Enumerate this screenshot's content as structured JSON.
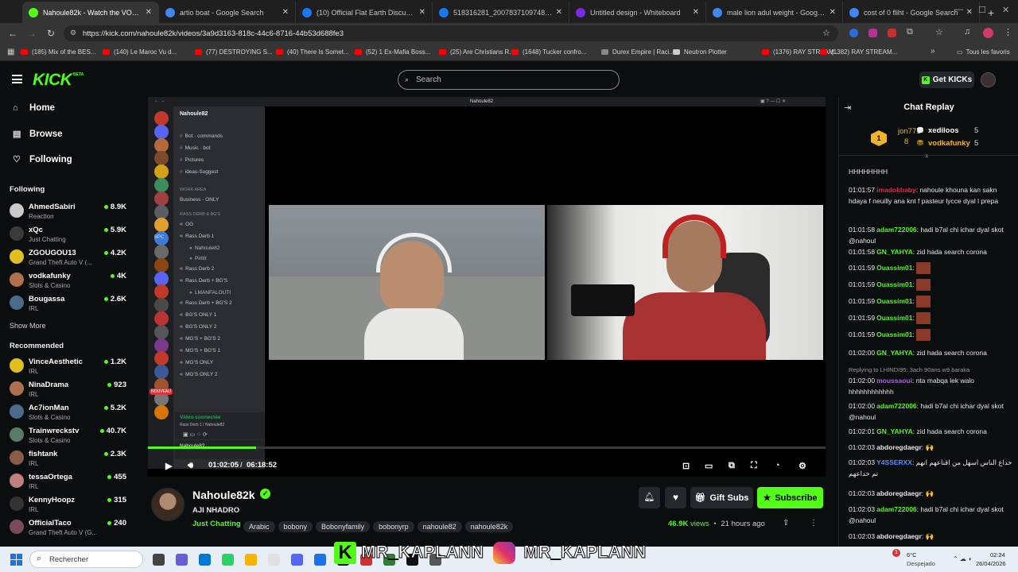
{
  "browser": {
    "tabs": [
      {
        "title": "Nahoule82k - Watch the VOD on",
        "active": true,
        "favicon": "kick-icon",
        "color": "#53fc18"
      },
      {
        "title": "artio boat - Google Search",
        "favicon": "google-icon",
        "color": "#4285f4"
      },
      {
        "title": "(10) Official Flat Earth Discussio",
        "favicon": "facebook-icon",
        "color": "#1877f2"
      },
      {
        "title": "518316281_20078371097482647",
        "favicon": "facebook-icon",
        "color": "#1877f2"
      },
      {
        "title": "Untitled design - Whiteboard",
        "favicon": "canva-icon",
        "color": "#7d2ae8"
      },
      {
        "title": "male lion adul weight - Google S",
        "favicon": "google-icon",
        "color": "#4285f4"
      },
      {
        "title": "cost of 0 fliht - Google Search",
        "favicon": "google-icon",
        "color": "#4285f4"
      }
    ],
    "new_tab": "+",
    "url": "https://kick.com/nahoule82k/videos/3a9d3163-818c-44c6-8716-44b53d688fe3",
    "bookmarks": [
      {
        "label": "(185) Mix of the BES..."
      },
      {
        "label": "(140) Le Maroc Vu d..."
      },
      {
        "label": "(77) DESTROYING S..."
      },
      {
        "label": "(40) There Is Somet..."
      },
      {
        "label": "(52) 1 Ex-Mafia Boss..."
      },
      {
        "label": "(25) Are Christians R..."
      },
      {
        "label": "(1648) Tucker confro..."
      },
      {
        "label": "Durex Empire | Raci..."
      },
      {
        "label": "Neutron Plotter"
      },
      {
        "label": "(1376) RAY STREAM..."
      },
      {
        "label": "(1382) RAY STREAM..."
      }
    ],
    "all_favorites": "Tous les favoris",
    "more": "»"
  },
  "header": {
    "logo": "KICK",
    "beta": "BETA",
    "search_placeholder": "Search",
    "get_kicks": "Get KICKs"
  },
  "sidebar": {
    "nav": [
      "Home",
      "Browse",
      "Following"
    ],
    "following_title": "Following",
    "following": [
      {
        "name": "AhmedSabiri",
        "category": "Reaction",
        "viewers": "8.9K"
      },
      {
        "name": "xQc",
        "category": "Just Chatting",
        "viewers": "5.9K"
      },
      {
        "name": "ZGOUGOU13",
        "category": "Grand Theft Auto V (...",
        "viewers": "4.2K"
      },
      {
        "name": "vodkafunky",
        "category": "Slots & Casino",
        "viewers": "4K"
      },
      {
        "name": "Bougassa",
        "category": "IRL",
        "viewers": "2.6K"
      }
    ],
    "show_more": "Show More",
    "recommended_title": "Recommended",
    "recommended": [
      {
        "name": "VinceAesthetic",
        "category": "IRL",
        "viewers": "1.2K"
      },
      {
        "name": "NinaDrama",
        "category": "IRL",
        "viewers": "923"
      },
      {
        "name": "Ac7ionMan",
        "category": "Slots & Casino",
        "viewers": "5.2K"
      },
      {
        "name": "Trainwreckstv",
        "category": "Slots & Casino",
        "viewers": "40.7K"
      },
      {
        "name": "fishtank",
        "category": "IRL",
        "viewers": "2.3K"
      },
      {
        "name": "tessaOrtega",
        "category": "IRL",
        "viewers": "455"
      },
      {
        "name": "KennyHoopz",
        "category": "IRL",
        "viewers": "315"
      },
      {
        "name": "OfficialTaco",
        "category": "Grand Theft Auto V (G...",
        "viewers": "240"
      }
    ]
  },
  "video": {
    "window_title": "Nahoule82",
    "discord": {
      "server": "Nahoule82",
      "channels": [
        {
          "name": "Bot · commands",
          "type": "hash"
        },
        {
          "name": "Music · bot",
          "type": "hash"
        },
        {
          "name": "Pictures",
          "type": "hash"
        },
        {
          "name": "ideas-Suggest",
          "type": "hash"
        }
      ],
      "category1": "WORK AREA",
      "business": "Business - ONLY",
      "category2": "RASS DERB & BG'S",
      "voice": [
        "OG",
        "Rass Derb 1",
        "Nahoule82",
        "Pirlitt",
        "Rass Derb 2",
        "Rass Derb + BG'S",
        "LMANFALOUTI",
        "Rass Derb + BG'S 2",
        "BG'S ONLY 1",
        "BG'S ONLY 2",
        "MG'S + BG'S 2",
        "MG'S + BG'S 1",
        "MG'S ONLY",
        "MG'S ONLY 2"
      ],
      "status_text": "Vidéo connectée",
      "status_sub": "Rass Derb 1 / Nahoule82",
      "user": "Nahoule82",
      "nouveau": "NOUVEAU",
      "bpc": "BPC"
    },
    "progress_fraction": 0.16,
    "time_current": "01:02:05",
    "time_total": "06:18:52"
  },
  "stream": {
    "channel": "Nahoule82k",
    "title": "AJI NHADRO",
    "category": "Just Chatting",
    "tags": [
      "Arabic",
      "bobony",
      "Bobonyfamily",
      "bobonyrp",
      "nahoule82",
      "nahoule82k"
    ],
    "views": "46.9K",
    "views_label": "views",
    "sep": "•",
    "posted": "21 hours ago",
    "gift_subs": "Gift Subs",
    "subscribe": "Subscribe"
  },
  "chat": {
    "title": "Chat Replay",
    "leaderboard": [
      {
        "name": "jon771",
        "count": "8"
      },
      {
        "name": "xediloos",
        "count": "5"
      },
      {
        "name": "vodkafunky",
        "count": "5"
      }
    ],
    "messages": [
      {
        "time": "",
        "user": "",
        "color": "#e8e8e8",
        "text": "HHHHHHHH"
      },
      {
        "time": "01:01:57",
        "user": "imadokbaby",
        "color": "#e0294d",
        "text": "nahoule khouna kan sakn hdaya f neuilly ana knt f pasteur lycce dyal l prepa"
      },
      {
        "time": "01:01:58",
        "user": "adam722006",
        "color": "#53fc18",
        "text": "hadi b7al chi ichar dyal skot @nahoul"
      },
      {
        "time": "01:01:58",
        "user": "GN_YAHYA",
        "color": "#53fc18",
        "text": "zid hada search corona"
      },
      {
        "time": "01:01:59",
        "user": "Ouassim01",
        "color": "#53fc18",
        "text": "",
        "emote": true
      },
      {
        "time": "01:01:59",
        "user": "Ouassim01",
        "color": "#53fc18",
        "text": "",
        "emote": true
      },
      {
        "time": "01:01:59",
        "user": "Ouassim01",
        "color": "#53fc18",
        "text": "",
        "emote": true
      },
      {
        "time": "01:01:59",
        "user": "Ouassim01",
        "color": "#53fc18",
        "text": "",
        "emote": true
      },
      {
        "time": "01:01:59",
        "user": "Ouassim01",
        "color": "#53fc18",
        "text": "",
        "emote": true
      },
      {
        "time": "01:02:00",
        "user": "GN_YAHYA",
        "color": "#53fc18",
        "text": "zid hada search corona"
      },
      {
        "time": "01:02:00",
        "user": "moussaoui",
        "color": "#b55cf0",
        "text": "nta mabqa lek walo hhhhhhhhhhhh",
        "reply": "Replying to LHINDI95: 3ach 90ans w9 baraka"
      },
      {
        "time": "01:02:00",
        "user": "adam722006",
        "color": "#53fc18",
        "text": "hadi b7al chi ichar dyal skot @nahoul"
      },
      {
        "time": "01:02:01",
        "user": "GN_YAHYA",
        "color": "#53fc18",
        "text": "zid hada search corona"
      },
      {
        "time": "01:02:03",
        "user": "abdoregdaegr",
        "color": "#e8e8e8",
        "text": "🙌"
      },
      {
        "time": "01:02:03",
        "user": "Y4SSERXX",
        "color": "#5b8cff",
        "text": "خداع الناس اسهل من اقناعهم انهم تم خداعهم"
      },
      {
        "time": "01:02:03",
        "user": "abdoregdaegr",
        "color": "#e8e8e8",
        "text": "🙌"
      },
      {
        "time": "01:02:03",
        "user": "adam722006",
        "color": "#53fc18",
        "text": "hadi b7al chi ichar dyal skot @nahoul"
      },
      {
        "time": "01:02:03",
        "user": "abdoregdaegr",
        "color": "#e8e8e8",
        "text": "🙌"
      }
    ]
  },
  "taskbar": {
    "search": "Rechercher",
    "weather_temp": "6°C",
    "weather_desc": "Despejado",
    "time": "02:24",
    "date": "26/04/2026",
    "notif": "1"
  },
  "watermark": {
    "left": "MR_KAPLANN",
    "right": "MR_KAPLANN"
  },
  "colors": {
    "accent": "#53fc18",
    "bg": "#0b0e0f"
  }
}
